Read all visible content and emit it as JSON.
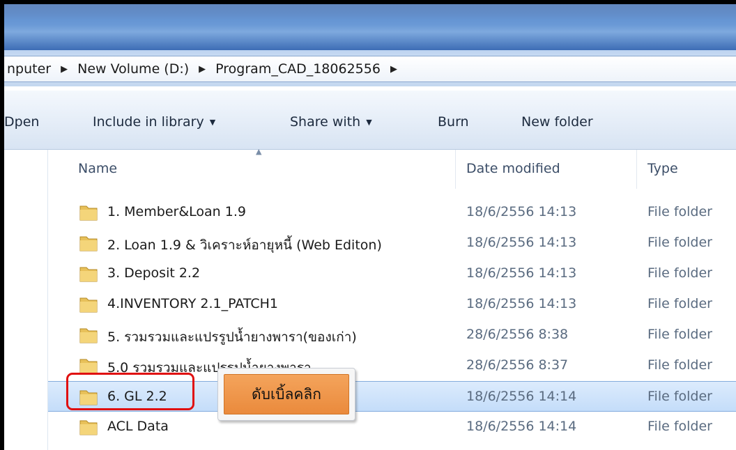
{
  "breadcrumb": {
    "items": [
      "nputer",
      "New Volume (D:)",
      "Program_CAD_18062556"
    ]
  },
  "toolbar": {
    "open_label": "Dpen",
    "include_label": "Include in library",
    "share_label": "Share with",
    "burn_label": "Burn",
    "newfolder_label": "New folder"
  },
  "columns": {
    "name": "Name",
    "date": "Date modified",
    "type": "Type"
  },
  "files": [
    {
      "name": "1. Member&Loan 1.9",
      "date": "18/6/2556 14:13",
      "type": "File folder"
    },
    {
      "name": "2. Loan 1.9 & วิเคราะห์อายุหนี้ (Web Editon)",
      "date": "18/6/2556 14:13",
      "type": "File folder"
    },
    {
      "name": "3. Deposit 2.2",
      "date": "18/6/2556 14:13",
      "type": "File folder"
    },
    {
      "name": "4.INVENTORY 2.1_PATCH1",
      "date": "18/6/2556 14:13",
      "type": "File folder"
    },
    {
      "name": "5. รวมรวมและแปรรูปน้ำยางพารา(ของเก่า)",
      "date": "28/6/2556 8:38",
      "type": "File folder"
    },
    {
      "name": "5.0 รวมรวมและแปรรูปน้ำยางพารา",
      "date": "28/6/2556 8:37",
      "type": "File folder"
    },
    {
      "name": "6. GL 2.2",
      "date": "18/6/2556 14:14",
      "type": "File folder"
    },
    {
      "name": "ACL Data",
      "date": "18/6/2556 14:14",
      "type": "File folder"
    }
  ],
  "callout": {
    "text": "ดับเบิ้ลคลิก"
  },
  "colors": {
    "highlight": "#e01010",
    "callout": "#ea8a3c",
    "selection": "#c4ddfa",
    "folder": "#e8c15a"
  }
}
